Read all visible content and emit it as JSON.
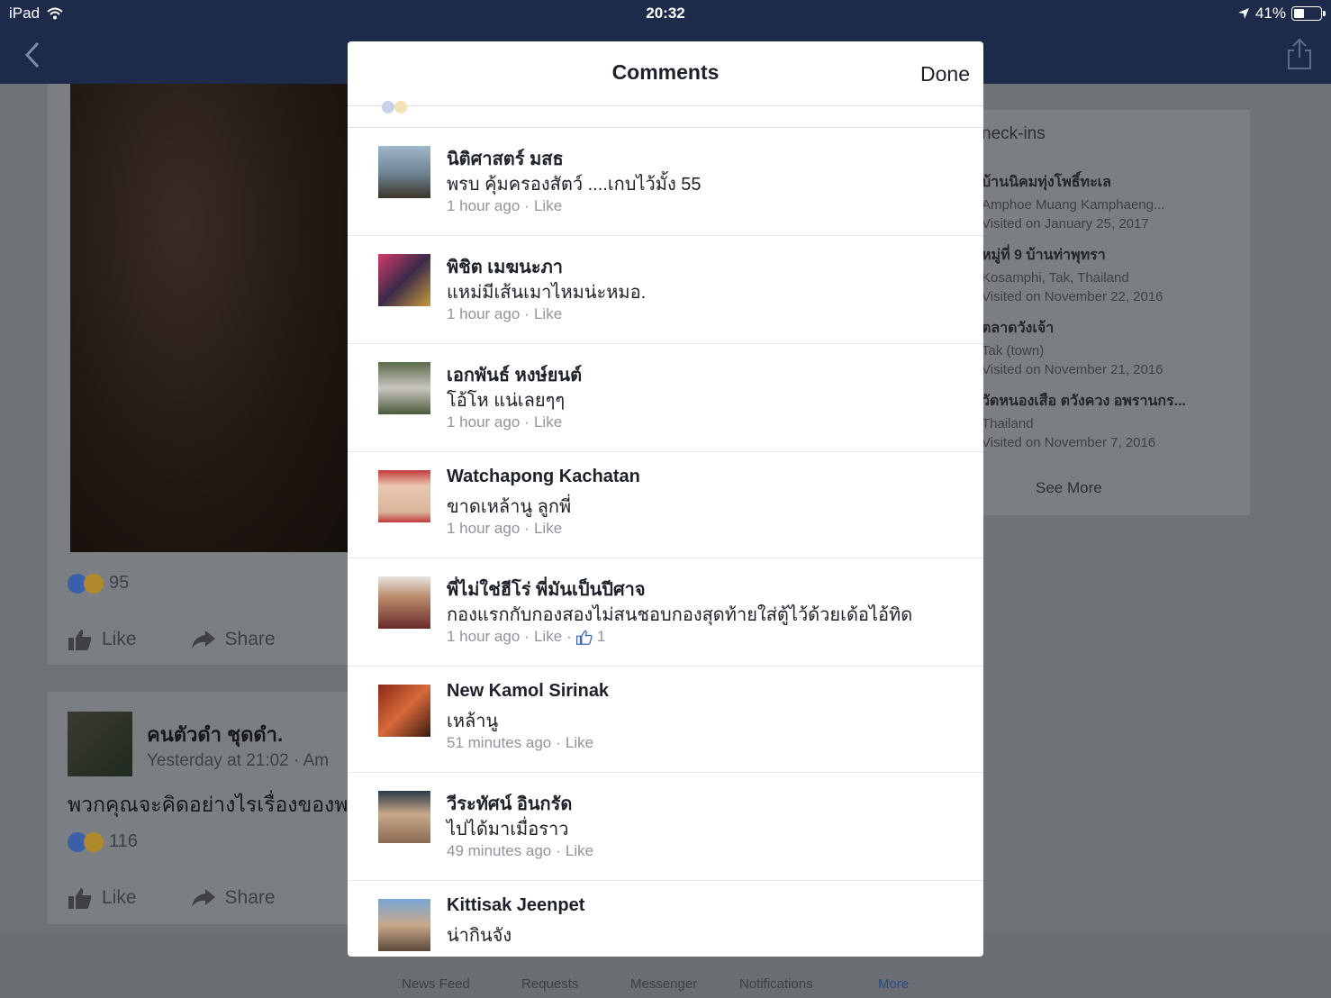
{
  "status": {
    "device": "iPad",
    "time": "20:32",
    "battery": "41%",
    "battery_level": 0.41
  },
  "feed": {
    "post1": {
      "reactions": "95",
      "like_label": "Like",
      "share_label": "Share"
    },
    "post2": {
      "author": "คนตัวดำ ชุดดำ.",
      "meta": "Yesterday at 21:02 · Am",
      "text": "พวกคุณจะคิดอย่างไรเรื่องของพ",
      "reactions": "116",
      "like_label": "Like",
      "share_label": "Share"
    }
  },
  "checkins": {
    "title": "neck-ins",
    "items": [
      {
        "name": "บ้านนิคมทุ่งโพธิ์ทะเล",
        "sub": "Amphoe Muang Kamphaeng...",
        "visited": "Visited on January 25, 2017"
      },
      {
        "name": "หมู่ที่ 9 บ้านท่าพุทรา",
        "sub": "Kosamphi, Tak, Thailand",
        "visited": "Visited on November 22, 2016"
      },
      {
        "name": "ตลาดวังเจ้า",
        "sub": "Tak (town)",
        "visited": "Visited on November 21, 2016"
      },
      {
        "name": "วัดหนองเสือ ตวังควง อพรานกร...",
        "sub": "Thailand",
        "visited": "Visited on November 7, 2016"
      }
    ],
    "see_more": "See More"
  },
  "tabbar": {
    "tabs": [
      "News Feed",
      "Requests",
      "Messenger",
      "Notifications",
      "More"
    ]
  },
  "modal": {
    "title": "Comments",
    "done_label": "Done",
    "comments": [
      {
        "name": "นิติศาสตร์ มสธ",
        "text": "พรบ คุ้มครองสัตว์ ....เกบไว้มั้ง 55",
        "time": "1 hour ago",
        "like": "Like",
        "likes": ""
      },
      {
        "name": "พิชิต เมฆนะภา",
        "text": "แหม่มีเส้นเมาไหมน่ะหมอ.",
        "time": "1 hour ago",
        "like": "Like",
        "likes": ""
      },
      {
        "name": "เอกพันธ์ หงษ์ยนต์",
        "text": "โอ้โห แน่เลยๆๆ",
        "time": "1 hour ago",
        "like": "Like",
        "likes": ""
      },
      {
        "name": "Watchapong Kachatan",
        "text": "ขาดเหล้านู ลูกพี่",
        "time": "1 hour ago",
        "like": "Like",
        "likes": ""
      },
      {
        "name": "พี่ไม่ใช่ฮีโร่ พี่มันเป็นปีศาจ",
        "text": "กองแรกกับกองสองไม่สนชอบกองสุดท้ายใส่ตู้ไว้ด้วยเด้อไอ้ทิด",
        "time": "1 hour ago",
        "like": "Like",
        "likes": "1"
      },
      {
        "name": "New Kamol Sirinak",
        "text": "เหล้านู",
        "time": "51 minutes ago",
        "like": "Like",
        "likes": ""
      },
      {
        "name": "วีระทัศน์ อินกรัด",
        "text": "ไปได้มาเมื่อราว",
        "time": "49 minutes ago",
        "like": "Like",
        "likes": ""
      },
      {
        "name": "Kittisak Jeenpet",
        "text": "น่ากินจัง",
        "time": "",
        "like": "",
        "likes": ""
      }
    ]
  }
}
